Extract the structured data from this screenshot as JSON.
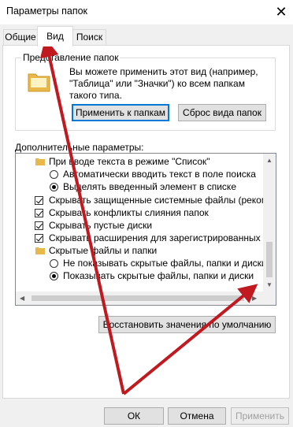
{
  "window": {
    "title": "Параметры папок",
    "close": "✕"
  },
  "tabs": [
    {
      "label": "Общие",
      "active": false
    },
    {
      "label": "Вид",
      "active": true
    },
    {
      "label": "Поиск",
      "active": false
    }
  ],
  "folder_view": {
    "caption": "Представление папок",
    "description": "Вы можете применить этот вид (например, \"Таблица\" или \"Значки\") ко всем папкам такого типа.",
    "apply_button": "Применить к папкам",
    "reset_button": "Сброс вида папок"
  },
  "advanced": {
    "label": "Дополнительные параметры:",
    "items": [
      {
        "kind": "folder",
        "text": "При вводе текста в режиме \"Список\""
      },
      {
        "kind": "radio",
        "checked": false,
        "text": "Автоматически вводить текст в поле поиска"
      },
      {
        "kind": "radio",
        "checked": true,
        "text": "Выделять введенный элемент в списке"
      },
      {
        "kind": "checkbox",
        "checked": true,
        "text": "Скрывать защищенные системные файлы (рекомен"
      },
      {
        "kind": "checkbox",
        "checked": true,
        "text": "Скрывать конфликты слияния папок"
      },
      {
        "kind": "checkbox",
        "checked": true,
        "text": "Скрывать пустые диски"
      },
      {
        "kind": "checkbox",
        "checked": true,
        "text": "Скрывать расширения для зарегистрированных типо"
      },
      {
        "kind": "folder",
        "text": "Скрытые файлы и папки"
      },
      {
        "kind": "radio",
        "checked": false,
        "text": "Не показывать скрытые файлы, папки и диски"
      },
      {
        "kind": "radio",
        "checked": true,
        "text": "Показывать скрытые файлы, папки и диски"
      }
    ]
  },
  "restore_button": "Восстановить значения по умолчанию",
  "footer": {
    "ok": "ОК",
    "cancel": "Отмена",
    "apply": "Применить"
  },
  "colors": {
    "annotation_arrow": "#c0191f",
    "folder": "#e8b84a",
    "default_button_border": "#0078d7"
  }
}
